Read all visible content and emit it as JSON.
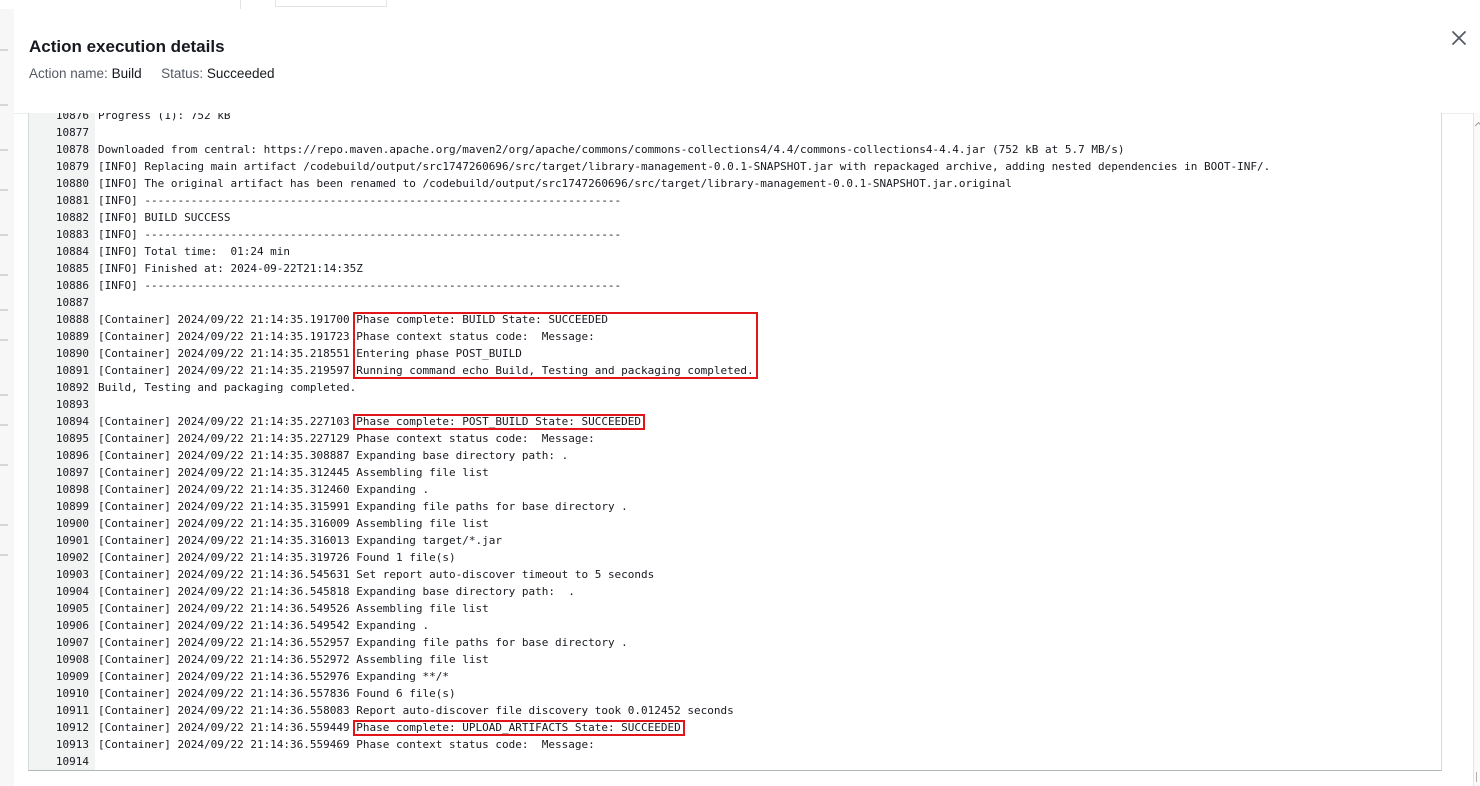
{
  "modal": {
    "title": "Action execution details",
    "action_name_label": "Action name:",
    "action_name_value": "Build",
    "status_label": "Status:",
    "status_value": "Succeeded"
  },
  "log": {
    "lines": [
      {
        "n": "10876",
        "prefix": "",
        "text": "Progress (1): 752 kB"
      },
      {
        "n": "10877",
        "prefix": "",
        "text": ""
      },
      {
        "n": "10878",
        "prefix": "",
        "text": "Downloaded from central: https://repo.maven.apache.org/maven2/org/apache/commons/commons-collections4/4.4/commons-collections4-4.4.jar (752 kB at 5.7 MB/s)"
      },
      {
        "n": "10879",
        "prefix": "",
        "text": "[INFO] Replacing main artifact /codebuild/output/src1747260696/src/target/library-management-0.0.1-SNAPSHOT.jar with repackaged archive, adding nested dependencies in BOOT-INF/."
      },
      {
        "n": "10880",
        "prefix": "",
        "text": "[INFO] The original artifact has been renamed to /codebuild/output/src1747260696/src/target/library-management-0.0.1-SNAPSHOT.jar.original"
      },
      {
        "n": "10881",
        "prefix": "",
        "text": "[INFO] ------------------------------------------------------------------------"
      },
      {
        "n": "10882",
        "prefix": "",
        "text": "[INFO] BUILD SUCCESS"
      },
      {
        "n": "10883",
        "prefix": "",
        "text": "[INFO] ------------------------------------------------------------------------"
      },
      {
        "n": "10884",
        "prefix": "",
        "text": "[INFO] Total time:  01:24 min"
      },
      {
        "n": "10885",
        "prefix": "",
        "text": "[INFO] Finished at: 2024-09-22T21:14:35Z"
      },
      {
        "n": "10886",
        "prefix": "",
        "text": "[INFO] ------------------------------------------------------------------------"
      },
      {
        "n": "10887",
        "prefix": "",
        "text": ""
      },
      {
        "n": "10888",
        "prefix": "[Container] 2024/09/22 21:14:35.191700 ",
        "text": "Phase complete: BUILD State: SUCCEEDED"
      },
      {
        "n": "10889",
        "prefix": "[Container] 2024/09/22 21:14:35.191723 ",
        "text": "Phase context status code:  Message:"
      },
      {
        "n": "10890",
        "prefix": "[Container] 2024/09/22 21:14:35.218551 ",
        "text": "Entering phase POST_BUILD"
      },
      {
        "n": "10891",
        "prefix": "[Container] 2024/09/22 21:14:35.219597 ",
        "text": "Running command echo Build, Testing and packaging completed."
      },
      {
        "n": "10892",
        "prefix": "",
        "text": "Build, Testing and packaging completed."
      },
      {
        "n": "10893",
        "prefix": "",
        "text": ""
      },
      {
        "n": "10894",
        "prefix": "[Container] 2024/09/22 21:14:35.227103 ",
        "text": "Phase complete: POST_BUILD State: SUCCEEDED"
      },
      {
        "n": "10895",
        "prefix": "[Container] 2024/09/22 21:14:35.227129 ",
        "text": "Phase context status code:  Message:"
      },
      {
        "n": "10896",
        "prefix": "[Container] 2024/09/22 21:14:35.308887 ",
        "text": "Expanding base directory path: ."
      },
      {
        "n": "10897",
        "prefix": "[Container] 2024/09/22 21:14:35.312445 ",
        "text": "Assembling file list"
      },
      {
        "n": "10898",
        "prefix": "[Container] 2024/09/22 21:14:35.312460 ",
        "text": "Expanding ."
      },
      {
        "n": "10899",
        "prefix": "[Container] 2024/09/22 21:14:35.315991 ",
        "text": "Expanding file paths for base directory ."
      },
      {
        "n": "10900",
        "prefix": "[Container] 2024/09/22 21:14:35.316009 ",
        "text": "Assembling file list"
      },
      {
        "n": "10901",
        "prefix": "[Container] 2024/09/22 21:14:35.316013 ",
        "text": "Expanding target/*.jar"
      },
      {
        "n": "10902",
        "prefix": "[Container] 2024/09/22 21:14:35.319726 ",
        "text": "Found 1 file(s)"
      },
      {
        "n": "10903",
        "prefix": "[Container] 2024/09/22 21:14:36.545631 ",
        "text": "Set report auto-discover timeout to 5 seconds"
      },
      {
        "n": "10904",
        "prefix": "[Container] 2024/09/22 21:14:36.545818 ",
        "text": "Expanding base directory path:  ."
      },
      {
        "n": "10905",
        "prefix": "[Container] 2024/09/22 21:14:36.549526 ",
        "text": "Assembling file list"
      },
      {
        "n": "10906",
        "prefix": "[Container] 2024/09/22 21:14:36.549542 ",
        "text": "Expanding ."
      },
      {
        "n": "10907",
        "prefix": "[Container] 2024/09/22 21:14:36.552957 ",
        "text": "Expanding file paths for base directory ."
      },
      {
        "n": "10908",
        "prefix": "[Container] 2024/09/22 21:14:36.552972 ",
        "text": "Assembling file list"
      },
      {
        "n": "10909",
        "prefix": "[Container] 2024/09/22 21:14:36.552976 ",
        "text": "Expanding **/*"
      },
      {
        "n": "10910",
        "prefix": "[Container] 2024/09/22 21:14:36.557836 ",
        "text": "Found 6 file(s)"
      },
      {
        "n": "10911",
        "prefix": "[Container] 2024/09/22 21:14:36.558083 ",
        "text": "Report auto-discover file discovery took 0.012452 seconds"
      },
      {
        "n": "10912",
        "prefix": "[Container] 2024/09/22 21:14:36.559449 ",
        "text": "Phase complete: UPLOAD_ARTIFACTS State: SUCCEEDED"
      },
      {
        "n": "10913",
        "prefix": "[Container] 2024/09/22 21:14:36.559469 ",
        "text": "Phase context status code:  Message:"
      },
      {
        "n": "10914",
        "prefix": "",
        "text": ""
      }
    ]
  },
  "colors": {
    "highlight_box": "#e0161a",
    "gutter_bg": "#f2f3f3",
    "title_text": "#16191f"
  },
  "icons": {
    "close": "close-icon"
  }
}
